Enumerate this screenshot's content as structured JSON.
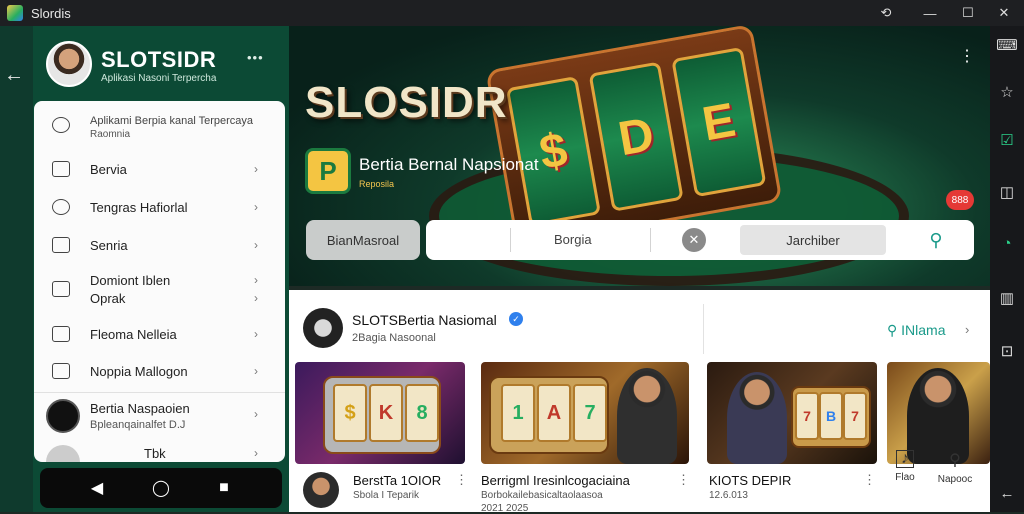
{
  "window": {
    "title": "Slordis",
    "controls": [
      "⟲",
      "—",
      "☐",
      "✕"
    ]
  },
  "drawer": {
    "brand": "SLOTSIDR",
    "brand_sub": "Aplikasi Nasoni Terpercha",
    "header_more": "•••",
    "intro_line1": "Aplikami Berpia kanal Terpercaya",
    "intro_line2": "Raomnia",
    "items": [
      {
        "label": "Bervia"
      },
      {
        "label": "Tengras Hafiorlal"
      },
      {
        "label": "Senria"
      },
      {
        "label": "Domiont Iblen",
        "label2": "Oprak"
      },
      {
        "label": "Fleoma Nelleia"
      },
      {
        "label": "Noppia Mallogon"
      }
    ],
    "profile_name": "Bertia Naspaoien",
    "profile_sub": "Bpleanqainalfet D.J",
    "profile2_label": "Tbk"
  },
  "hero": {
    "title": "SLOSIDR",
    "subtitle": "Bertia Bernal Napsionat",
    "subtitle2": "Reposila",
    "reels": [
      "$",
      "D",
      "E"
    ],
    "badge": "P",
    "red_badge": "888",
    "more": "⋮"
  },
  "search": {
    "filter_label": "BianMasroal",
    "label": "Borgia",
    "field_value": "Jarchiber",
    "clear": "✕",
    "search_icon": "⚲"
  },
  "channel": {
    "name": "SLOTSBertia Nasiomal",
    "subline": "2Bagia Nasoonal",
    "explore_label": "INlama",
    "verified": "✓"
  },
  "cards": [
    {
      "title": "BerstTa 1OIOR",
      "sub": "Sbola I Teparik",
      "reels": [
        "$",
        "K",
        "8"
      ]
    },
    {
      "title": "Berrigml Iresinlcogaciaina",
      "sub": "Borbokailebasicaltaolaasoa",
      "sub2": "2021 2025",
      "reels": [
        "1",
        "A",
        "7"
      ]
    },
    {
      "title": "KIOTS DEPIR",
      "sub": "12.6.013",
      "reels": [
        "7",
        "B",
        "7"
      ]
    },
    {
      "title": "",
      "sub": ""
    }
  ],
  "bottom_tabs": [
    {
      "label": "Flao",
      "icon": "♪"
    },
    {
      "label": "Napooc",
      "icon": "⚲"
    }
  ],
  "colors": {
    "accent": "#1a9a8a",
    "drawer_bg": "#0c4a35",
    "badge_red": "#e53935",
    "gold": "#f4c542"
  }
}
